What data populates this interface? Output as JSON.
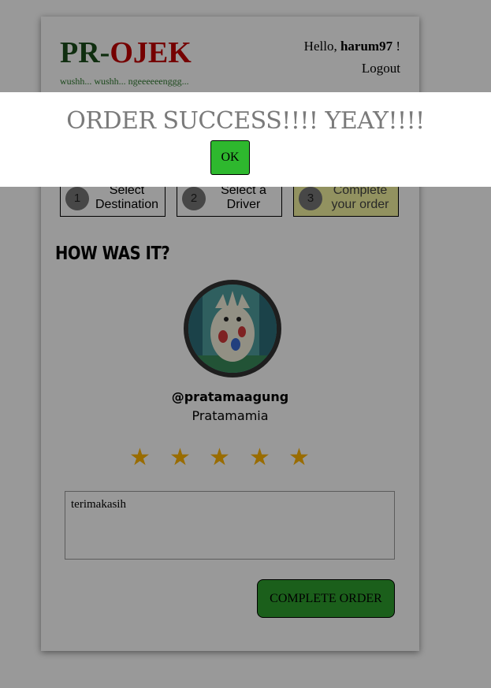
{
  "header": {
    "logo_pr": "PR",
    "logo_dash": "-",
    "logo_ojek": "OJEK",
    "tagline": "wushh... wushh... ngeeeeeenggg...",
    "greeting_prefix": "Hello, ",
    "username": "harum97",
    "greeting_suffix": " !",
    "logout": "Logout"
  },
  "steps": [
    {
      "num": "1",
      "label": "Select Destination"
    },
    {
      "num": "2",
      "label": "Select a Driver"
    },
    {
      "num": "3",
      "label": "Complete your order"
    }
  ],
  "rating": {
    "heading": "HOW WAS IT?",
    "driver_username": "@pratamaagung",
    "driver_name": "Pratamamia",
    "stars": [
      "★",
      "★",
      "★",
      "★",
      "★"
    ],
    "star_color": "#ffb400",
    "comment": "terimakasih"
  },
  "actions": {
    "complete_order": "COMPLETE ORDER"
  },
  "modal": {
    "message": "ORDER SUCCESS!!!! YEAY!!!!",
    "ok": "OK"
  },
  "colors": {
    "logo_green": "#1b4d1b",
    "logo_red": "#c40000",
    "button_green": "#2e9e2e",
    "active_step": "#f4f4a0"
  }
}
